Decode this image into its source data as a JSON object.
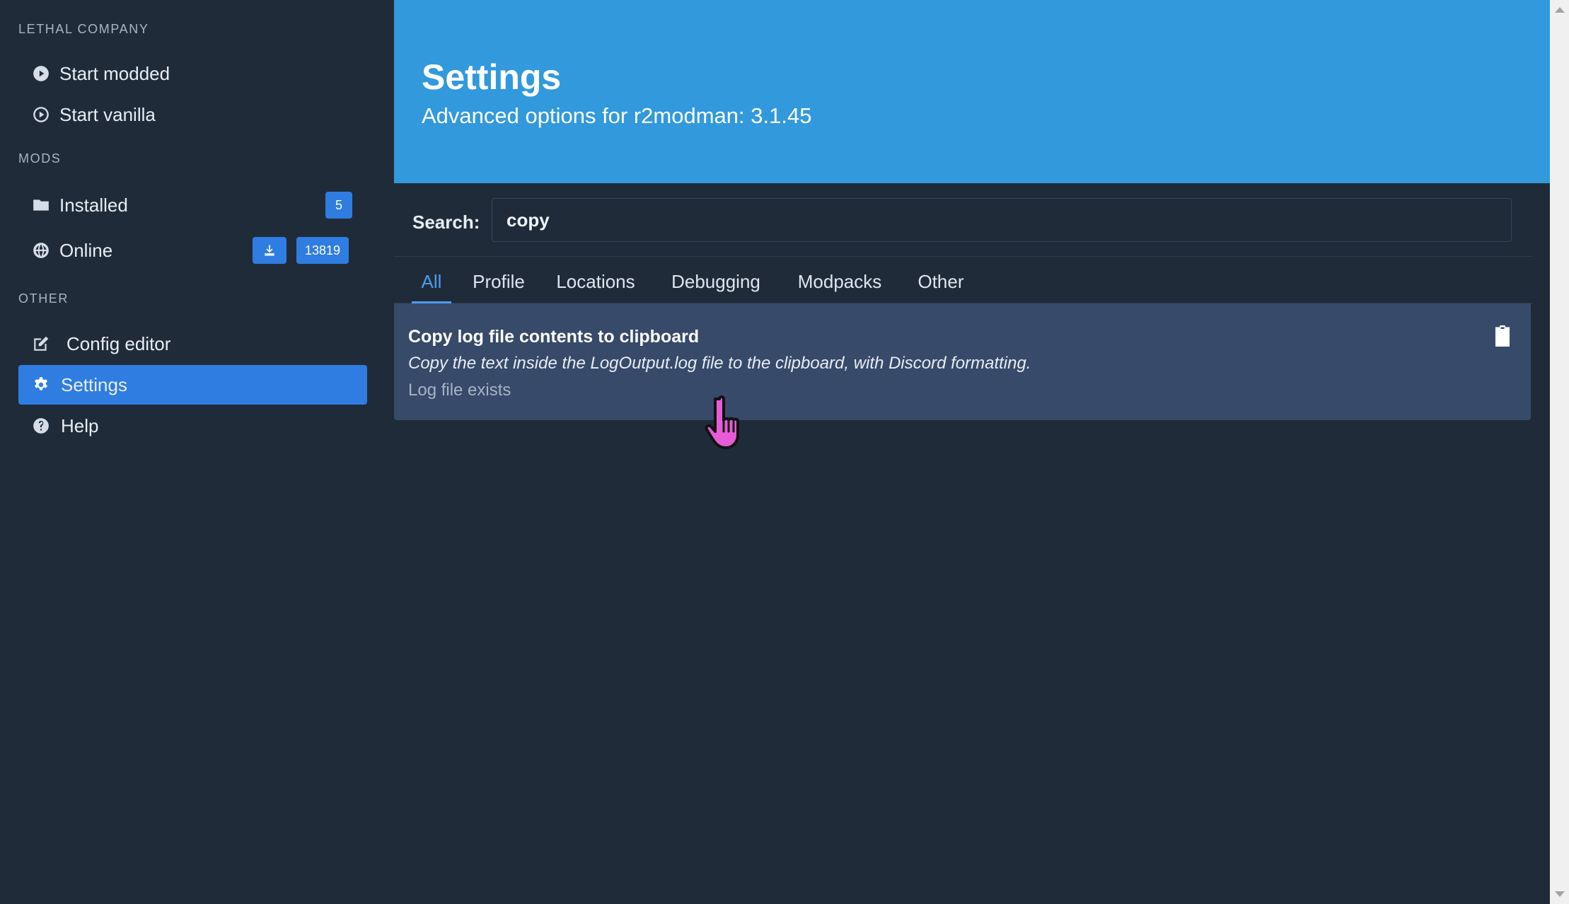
{
  "sidebar": {
    "game_section": "LETHAL COMPANY",
    "start_modded": "Start modded",
    "start_vanilla": "Start vanilla",
    "mods_section": "MODS",
    "installed": {
      "label": "Installed",
      "count": "5"
    },
    "online": {
      "label": "Online",
      "count": "13819"
    },
    "other_section": "OTHER",
    "config_editor": "Config editor",
    "settings": "Settings",
    "help": "Help"
  },
  "hero": {
    "title": "Settings",
    "subtitle": "Advanced options for r2modman: 3.1.45"
  },
  "search": {
    "label": "Search:",
    "value": "copy"
  },
  "tabs": [
    "All",
    "Profile",
    "Locations",
    "Debugging",
    "Modpacks",
    "Other"
  ],
  "active_tab": "All",
  "setting": {
    "title": "Copy log file contents to clipboard",
    "description": "Copy the text inside the LogOutput.log file to the clipboard, with Discord formatting.",
    "status": "Log file exists",
    "icon": "clipboard-icon"
  },
  "colors": {
    "background": "#202b3a",
    "hero": "#3299dd",
    "accent": "#2f7de1",
    "card": "#374a6a",
    "active_tab": "#4b9df0"
  }
}
